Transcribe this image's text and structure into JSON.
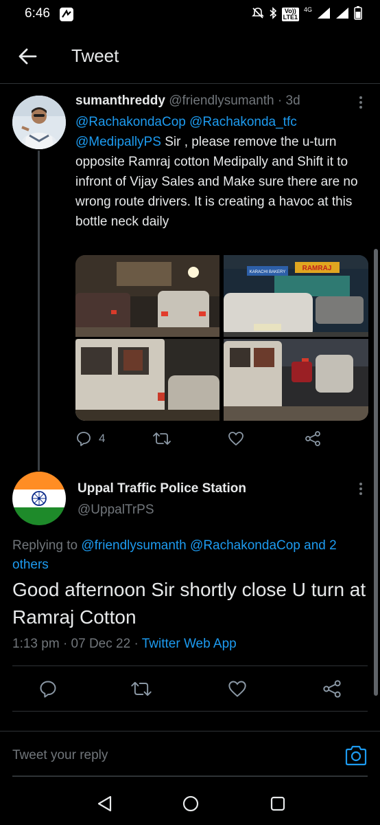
{
  "status_bar": {
    "time": "6:46",
    "lte_top": "Vo))",
    "lte_bottom": "LTE1",
    "network": "4G",
    "icons": [
      "notifications-off-icon",
      "bluetooth-icon",
      "signal-icon",
      "signal-icon",
      "battery-icon"
    ]
  },
  "header": {
    "title": "Tweet",
    "back_icon": "arrow-left-icon"
  },
  "tweet1": {
    "name": "sumanthreddy",
    "handle": "@friendlysumanth",
    "separator": "·",
    "age": "3d",
    "mentions": [
      "@RachakondaCop",
      "@Rachakonda_tfc",
      "@MedipallyPS"
    ],
    "text": "Sir , please remove the u-turn opposite Ramraj cotton Medipally and Shift it to infront of Vijay Sales and Make sure there are no wrong route drivers. It is creating a havoc at this bottle neck daily",
    "photo_signs": {
      "ramraj": "RAMRAJ",
      "bakery": "KARACHI BAKERY"
    },
    "reply_count": "4",
    "action_icons": [
      "reply-icon",
      "retweet-icon",
      "like-icon",
      "share-icon"
    ]
  },
  "tweet2": {
    "name": "Uppal Traffic Police Station",
    "handle": "@UppalTrPS",
    "replying_prefix": "Replying to",
    "replying_to": "@friendlysumanth @RachakondaCop",
    "replying_and": "and",
    "replying_others": "2 others",
    "text": "Good afternoon Sir shortly close U turn at Ramraj Cotton",
    "time": "1:13 pm",
    "date": "07 Dec 22",
    "separator": "·",
    "source": "Twitter Web App"
  },
  "reply_bar": {
    "placeholder": "Tweet your reply",
    "camera_icon": "camera-icon"
  },
  "nav": {
    "icons": [
      "back-triangle-icon",
      "home-circle-icon",
      "recents-square-icon"
    ]
  },
  "colors": {
    "background": "#000000",
    "accent": "#1d9bf0",
    "muted": "#71767b",
    "text": "#e7e9ea",
    "divider": "#2f3336"
  }
}
